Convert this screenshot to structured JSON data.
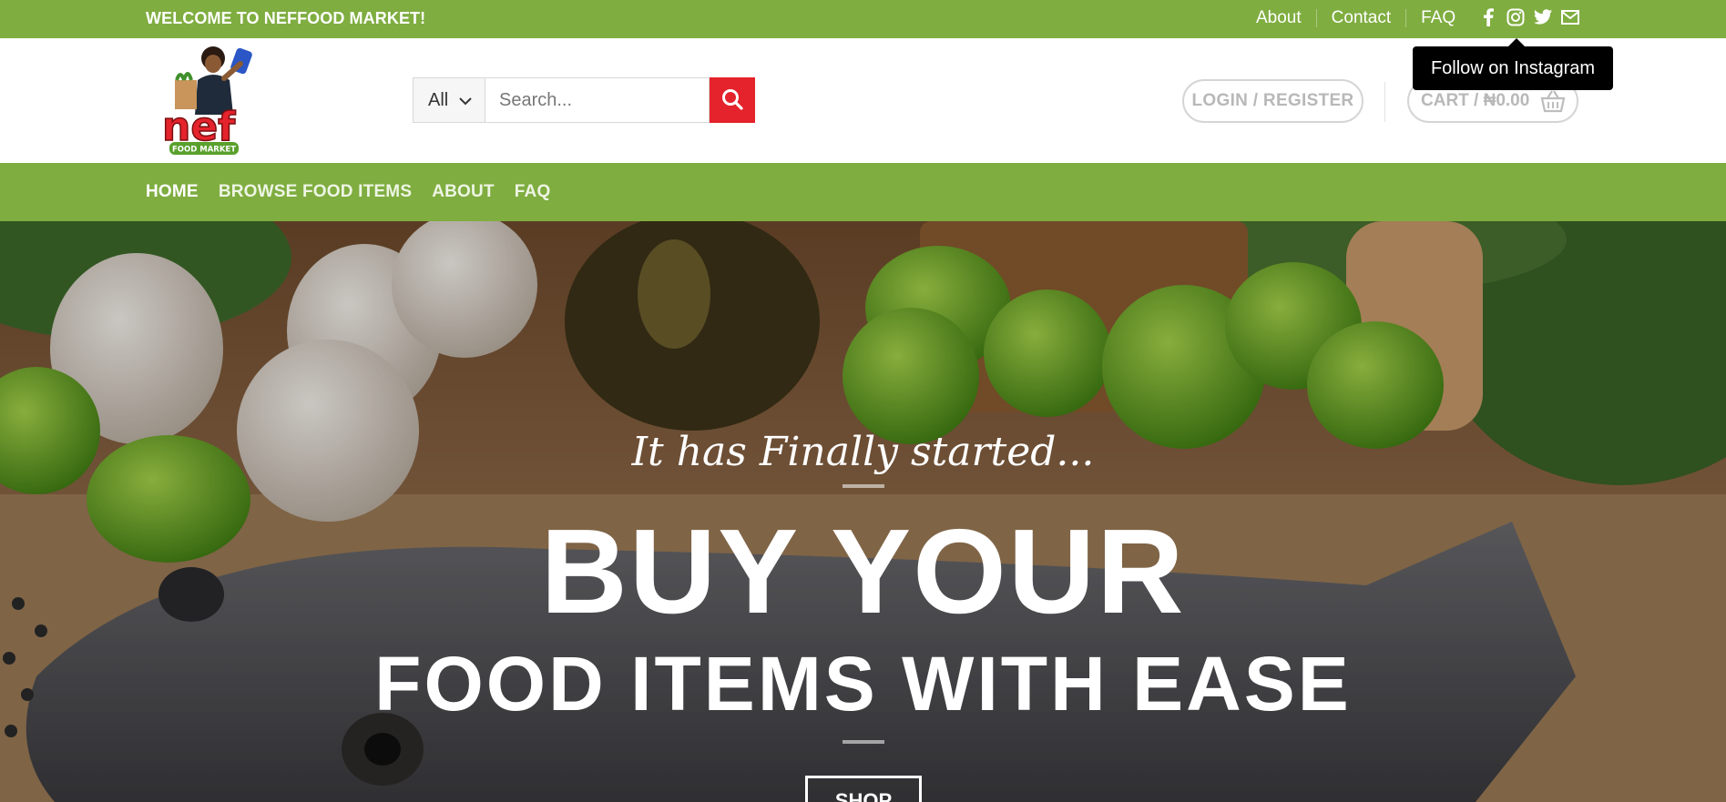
{
  "topbar": {
    "welcome": "WELCOME TO NEFFOOD MARKET!",
    "links": [
      "About",
      "Contact",
      "FAQ"
    ],
    "social_icons": [
      "facebook-icon",
      "instagram-icon",
      "twitter-icon",
      "envelope-icon"
    ]
  },
  "tooltip": {
    "text": "Follow on Instagram"
  },
  "logo": {
    "brand": "nef",
    "subtitle": "FOOD MARKET"
  },
  "search": {
    "category": "All",
    "placeholder": "Search...",
    "icon": "search-icon"
  },
  "account": {
    "login_label": "LOGIN / REGISTER"
  },
  "cart": {
    "label": "CART / ₦0.00",
    "icon": "basket-icon"
  },
  "nav": {
    "items": [
      "HOME",
      "BROWSE FOOD ITEMS",
      "ABOUT",
      "FAQ"
    ]
  },
  "hero": {
    "tagline": "It has Finally started...",
    "headline_line1": "BUY YOUR",
    "headline_line2": "FOOD ITEMS WITH EASE",
    "cta_label": "SHOP"
  },
  "colors": {
    "brand_green": "#7fad40",
    "search_red": "#e4232c",
    "muted_text": "#b8b8b8"
  }
}
